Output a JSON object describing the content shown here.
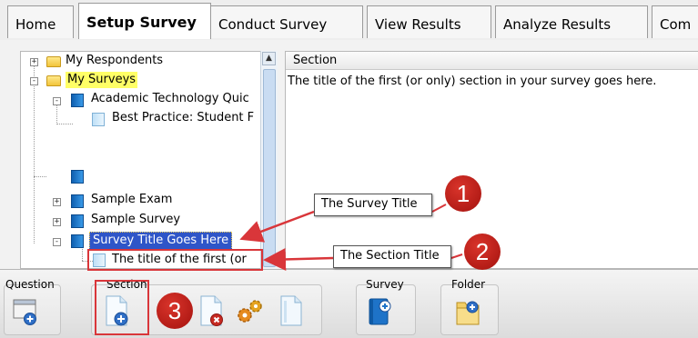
{
  "tabs": [
    {
      "label": "Home"
    },
    {
      "label": "Setup Survey",
      "active": true
    },
    {
      "label": "Conduct Survey"
    },
    {
      "label": "View Results"
    },
    {
      "label": "Analyze Results"
    },
    {
      "label": "Com"
    }
  ],
  "tree": {
    "items": [
      {
        "label": "My Respondents",
        "type": "folder",
        "expander": "+"
      },
      {
        "label": "My Surveys",
        "type": "folder",
        "expander": "-",
        "highlight": "yellow"
      },
      {
        "label": "Academic Technology Quic",
        "type": "survey",
        "expander": "-"
      },
      {
        "label": "Best Practice: Student F",
        "type": "section"
      },
      {
        "label": "",
        "type": "survey"
      },
      {
        "label": "Sample Exam",
        "type": "survey",
        "expander": "+"
      },
      {
        "label": "Sample Survey",
        "type": "survey",
        "expander": "+"
      },
      {
        "label": "Survey Title Goes Here",
        "type": "survey",
        "expander": "-",
        "selected": true
      },
      {
        "label": "The title of the first (or",
        "type": "section"
      }
    ]
  },
  "grid": {
    "header": "Section",
    "cell": "The title of the first (or only) section in your survey goes here."
  },
  "toolbar": {
    "groups": [
      {
        "label": "Question"
      },
      {
        "label": "Section"
      },
      {
        "label": "Survey"
      },
      {
        "label": "Folder"
      }
    ]
  },
  "annotations": {
    "survey_title_callout": "The Survey Title",
    "section_title_callout": "The Section Title",
    "num1": "1",
    "num2": "2",
    "num3": "3"
  },
  "colors": {
    "annotation_red": "#d9363a",
    "selected_blue": "#2e55c8",
    "highlight_yellow": "#ffff66"
  }
}
